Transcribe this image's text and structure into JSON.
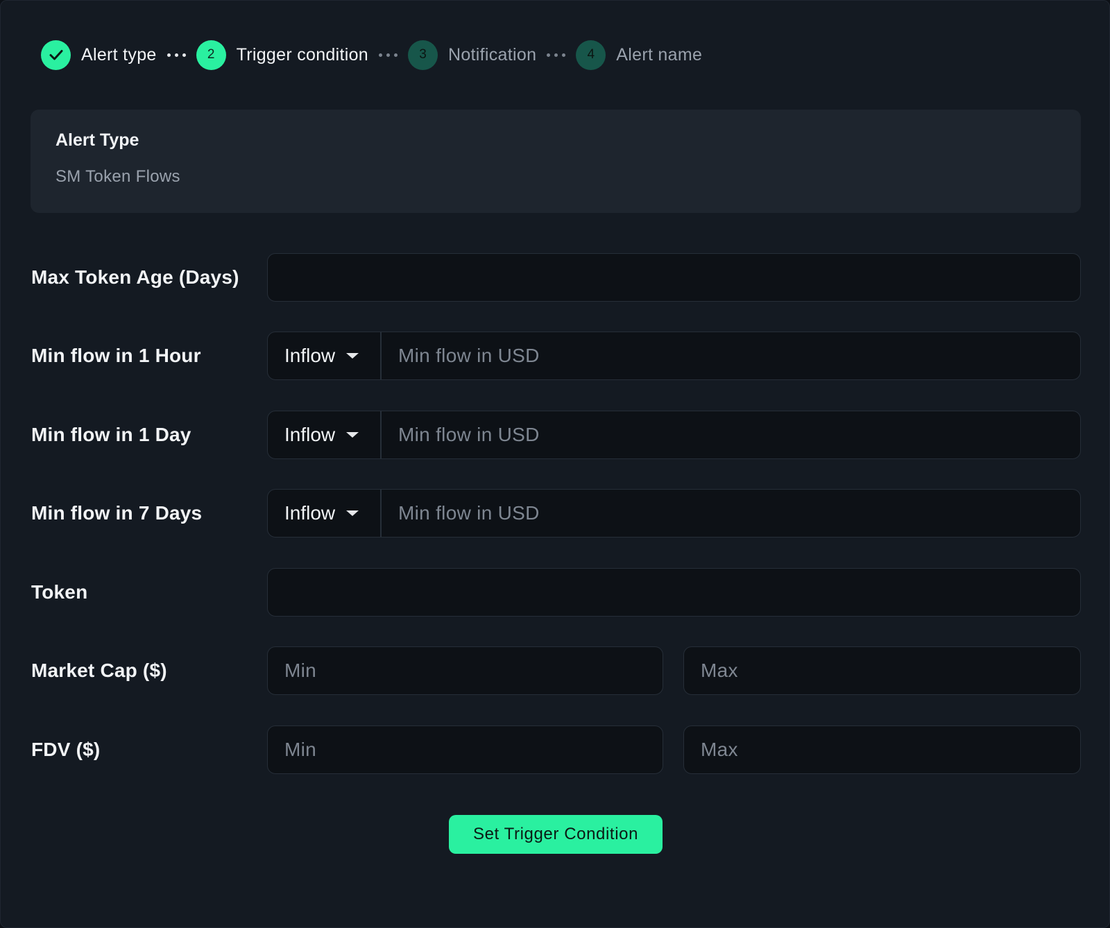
{
  "stepper": {
    "steps": [
      {
        "number": "",
        "label": "Alert type",
        "state": "done"
      },
      {
        "number": "2",
        "label": "Trigger condition",
        "state": "active"
      },
      {
        "number": "3",
        "label": "Notification",
        "state": "todo"
      },
      {
        "number": "4",
        "label": "Alert name",
        "state": "todo"
      }
    ]
  },
  "summary": {
    "title": "Alert Type",
    "value": "SM Token Flows"
  },
  "form": {
    "max_token_age": {
      "label": "Max Token Age (Days)",
      "placeholder": ""
    },
    "flow_1h": {
      "label": "Min flow in 1 Hour",
      "direction": "Inflow",
      "placeholder": "Min flow in USD"
    },
    "flow_1d": {
      "label": "Min flow in 1 Day",
      "direction": "Inflow",
      "placeholder": "Min flow in USD"
    },
    "flow_7d": {
      "label": "Min flow in 7 Days",
      "direction": "Inflow",
      "placeholder": "Min flow in USD"
    },
    "token": {
      "label": "Token",
      "placeholder": ""
    },
    "market_cap": {
      "label": "Market Cap ($)",
      "min_placeholder": "Min",
      "max_placeholder": "Max"
    },
    "fdv": {
      "label": "FDV ($)",
      "min_placeholder": "Min",
      "max_placeholder": "Max"
    }
  },
  "submit_label": "Set Trigger Condition",
  "colors": {
    "accent": "#2af0a0",
    "step_todo": "#17564a",
    "background": "#141a22",
    "input_background": "#0d1116"
  }
}
